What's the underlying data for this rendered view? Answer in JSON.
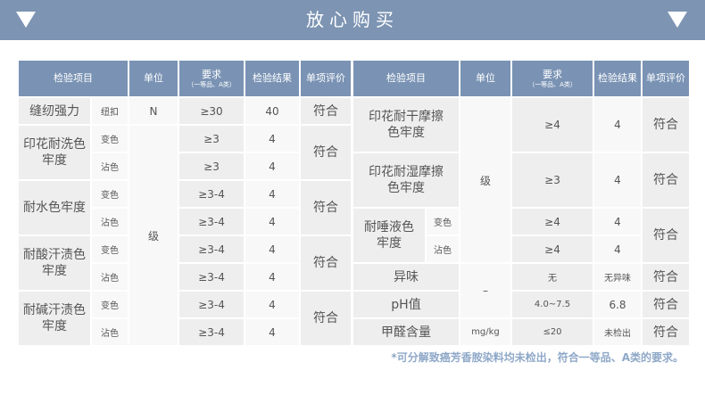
{
  "title": "放心购买",
  "header": {
    "item": "检验项目",
    "unit": "单位",
    "req": "要求",
    "req_sub": "（一等品、A类）",
    "result": "检验结果",
    "eval": "单项评价"
  },
  "left": {
    "seam": {
      "name": "缝纫强力",
      "sub": "纽扣",
      "unit": "N",
      "req": "≥30",
      "result": "40",
      "eval": "符合"
    },
    "wash": {
      "name": "印花耐洗色牢度",
      "r1": {
        "sub": "变色",
        "req": "≥3",
        "result": "4"
      },
      "r2": {
        "sub": "沾色",
        "req": "≥3",
        "result": "4"
      },
      "eval": "符合"
    },
    "water": {
      "name": "耐水色牢度",
      "r1": {
        "sub": "变色",
        "req": "≥3-4",
        "result": "4"
      },
      "r2": {
        "sub": "沾色",
        "req": "≥3-4",
        "result": "4"
      },
      "eval": "符合"
    },
    "acid": {
      "name": "耐酸汗渍色牢度",
      "r1": {
        "sub": "变色",
        "req": "≥3-4",
        "result": "4"
      },
      "r2": {
        "sub": "沾色",
        "req": "≥3-4",
        "result": "4"
      },
      "eval": "符合"
    },
    "alkali": {
      "name": "耐碱汗渍色牢度",
      "r1": {
        "sub": "变色",
        "req": "≥3-4",
        "result": "4"
      },
      "r2": {
        "sub": "沾色",
        "req": "≥3-4",
        "result": "4"
      },
      "eval": "符合"
    },
    "grade_unit": "级"
  },
  "right": {
    "dry": {
      "name": "印花耐干摩擦色牢度",
      "req": "≥4",
      "result": "4",
      "eval": "符合"
    },
    "wet": {
      "name": "印花耐湿摩擦色牢度",
      "req": "≥3",
      "result": "4",
      "eval": "符合"
    },
    "saliva": {
      "name": "耐唾液色牢度",
      "r1": {
        "sub": "变色",
        "req": "≥4",
        "result": "4"
      },
      "r2": {
        "sub": "沾色",
        "req": "≥4",
        "result": "4"
      },
      "eval": "符合"
    },
    "grade_unit": "级",
    "odor": {
      "name": "异味",
      "req": "无",
      "result": "无异味",
      "eval": "符合"
    },
    "ph": {
      "name": "pH值",
      "req": "4.0~7.5",
      "result": "6.8",
      "eval": "符合"
    },
    "dash_unit": "–",
    "formaldehyde": {
      "name": "甲醛含量",
      "unit": "mg/kg",
      "req": "≤20",
      "result": "未检出",
      "eval": "符合"
    }
  },
  "note": "*可分解致癌芳香胺染料均未检出，符合一等品、A类的要求。",
  "colors": {
    "banner": "#7d94b3",
    "header": "#7a93b4",
    "note": "#8fa8c8"
  }
}
